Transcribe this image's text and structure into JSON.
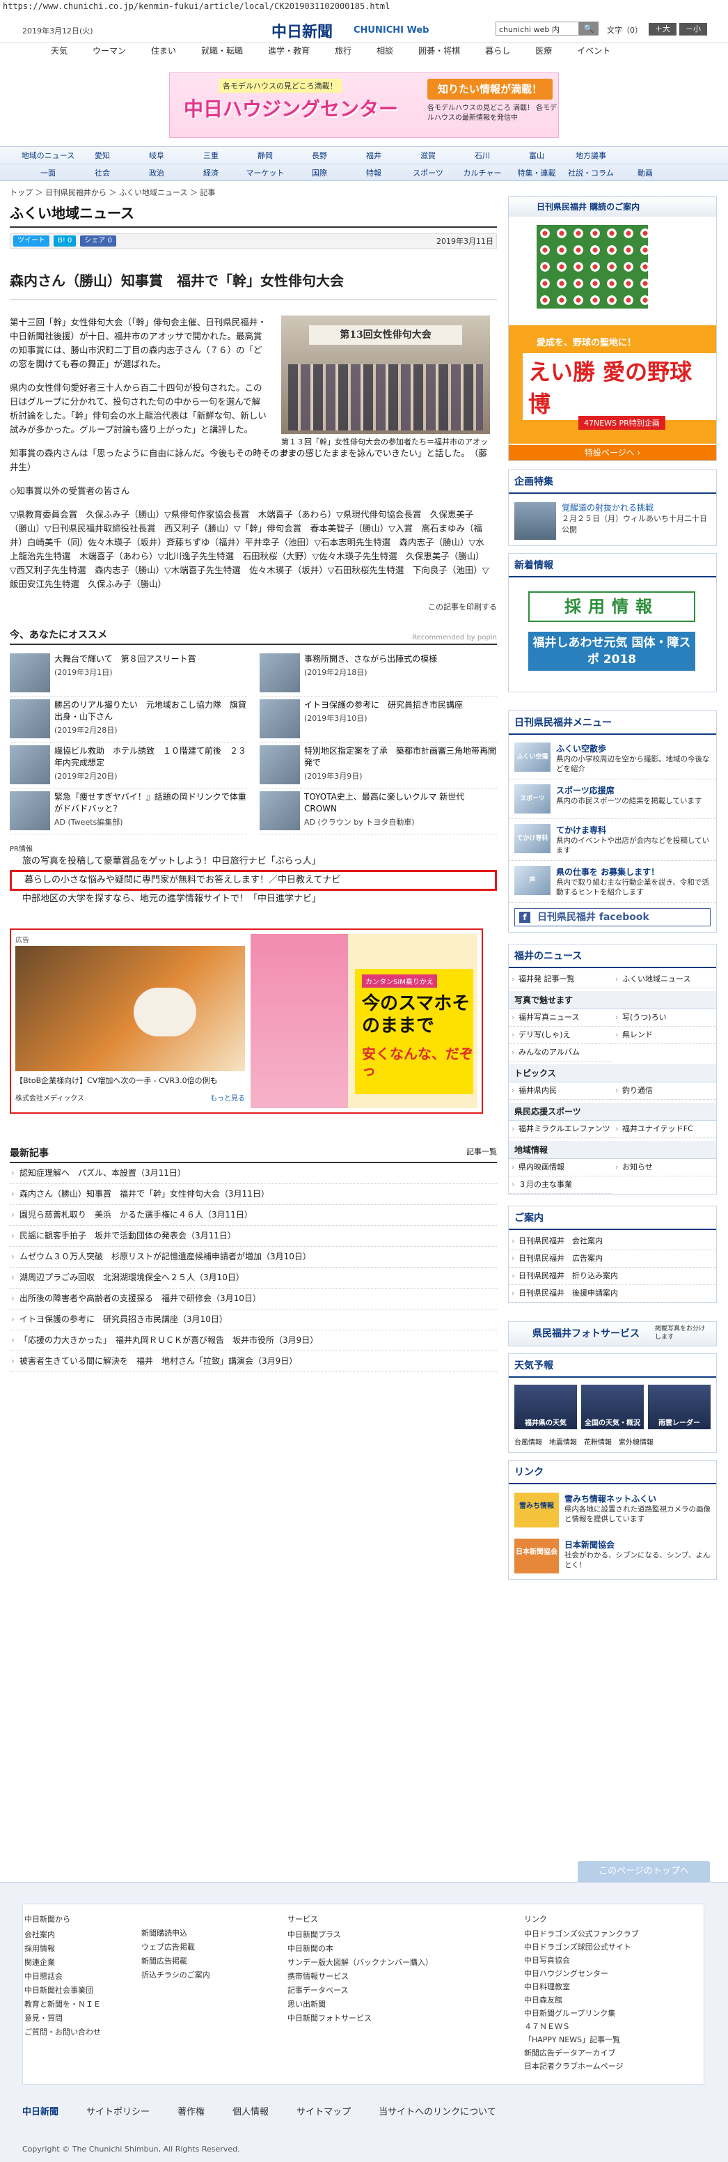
{
  "url_bar": "https://www.chunichi.co.jp/kenmin-fukui/article/local/CK2019031102000185.html",
  "header": {
    "date": "2019年3月12日(火)",
    "logo": "中日新聞",
    "logo_sub": "CHUNICHI Web",
    "search_value": "chunichi web 内",
    "search_btn": "🔍",
    "fontsize_label": "文字（0）",
    "font_big": "＋大",
    "font_small": "－小",
    "gnav": [
      "天気",
      "ウーマン",
      "住まい",
      "就職・転職",
      "進学・教育",
      "旅行",
      "相談",
      "囲碁・将棋",
      "暮らし",
      "医療",
      "イベント"
    ]
  },
  "banner": {
    "sub": "各モデルハウスの見どころ満載！",
    "title": "中日ハウジングセンター",
    "right": "知りたい情報が満載！",
    "right2": "各モデルハウスの見どころ 満載！ 各モデルハウスの最新情報を発信中"
  },
  "cat_nav": {
    "row1": [
      "地域のニュース",
      "愛知",
      "岐阜",
      "三重",
      "静岡",
      "長野",
      "福井",
      "滋賀",
      "石川",
      "富山",
      "地方議事"
    ],
    "row2": [
      "一面",
      "社会",
      "政治",
      "経済",
      "マーケット",
      "国際",
      "特報",
      "スポーツ",
      "カルチャー",
      "特集・連載",
      "社説・コラム",
      "動画"
    ]
  },
  "main": {
    "breadcrumb": "トップ ＞ 日刊県民福井から ＞ ふくい地域ニュース ＞ 記事",
    "section_title": "ふくい地域ニュース",
    "social": {
      "tweet": "ツイート",
      "b": "B! 0",
      "share": "シェア 0"
    },
    "pubdate": "2019年3月11日",
    "article_title": "森内さん（勝山）知事賞　福井で「幹」女性俳句大会",
    "p1": "第十三回「幹」女性俳句大会（「幹」俳句会主催、日刊県民福井・中日新聞社後援）が十日、福井市のアオッサで開かれた。最高賞の知事賞には、勝山市沢町二丁目の森内志子さん（７６）の「どの窓を開けても春の舞正」が選ばれた。",
    "p2": "県内の女性俳句愛好者三十人から百二十四句が投句された。この日はグループに分かれて、投句された句の中から一句を選んで解析討論をした。「幹」俳句会の水上龍治代表は「新鮮な句、新しい試みが多かった。グループ討論も盛り上がった」と講評した。",
    "p3": "知事賞の森内さんは「思ったように自由に詠んだ。今後もその時そのままの感じたままを詠んでいきたい」と話した。　（藤井生）",
    "p4": "◇知事賞以外の受賞者の皆さん",
    "p5": "▽県教育委員会賞　久保ふみ子（勝山）▽県俳句作家協会長賞　木端喜子（あわら）▽県現代俳句協会長賞　久保恵美子（勝山）▽日刊県民福井取締役社長賞　西又利子（勝山）▽「幹」俳句会賞　春本美智子（勝山）▽入賞　高石まゆみ（福井）白崎美千（同）佐々木瑛子（坂井）斉藤ちずゆ（福井）平井幸子（池田）▽石本志明先生特選　森内志子（勝山）▽水上龍治先生特選　木端喜子（あわら）▽北川逸子先生特選　石田秋桜（大野）▽佐々木瑛子先生特選　久保恵美子（勝山）▽西又利子先生特選　森内志子（勝山）▽木端喜子先生特選　佐々木瑛子（坂井）▽石田秋桜先生特選　下向良子（池田）▽飯田安江先生特選　久保ふみ子（勝山）",
    "photo_cap": "第１３回「幹」女性俳句大会の参加者たち＝福井市のアオッサで",
    "photo_banner": "第13回女性俳句大会",
    "print_link": "この記事を印刷する",
    "rec_title": "今、あなたにオススメ",
    "rec_by": "Recommended by popIn",
    "recs": [
      {
        "t": "大舞台で輝いて　第８回アスリート賞",
        "d": "(2019年3月1日)"
      },
      {
        "t": "事務所開き、さながら出陣式の模様",
        "d": "(2019年2月18日)"
      },
      {
        "t": "勝呂のリアル撮りたい　元地域おこし協力隊　旗貸出身・山下さん",
        "d": "(2019年2月28日)"
      },
      {
        "t": "イトヨ保護の参考に　研究員招き市民講座",
        "d": "(2019年3月10日)"
      },
      {
        "t": "繊協ビル救助　ホテル誘致　１０階建て前後　２３年内完成想定",
        "d": "(2019年2月20日)"
      },
      {
        "t": "特別地区指定案を了承　築都市計画審三角地帯再開発で",
        "d": "(2019年3月9日)"
      },
      {
        "t": "緊急『痩せすぎヤバイ！』話題の岡ドリンクで体重がドバドバッと？",
        "d": "AD (Tweets編集部)"
      },
      {
        "t": "TOYOTA史上、最高に楽しいクルマ 新世代CROWN",
        "d": "AD (クラウン by トヨタ自動車)"
      }
    ],
    "pr_label": "PR情報",
    "pr": [
      "旅の写真を投稿して豪華賞品をゲットしよう！中日旅行ナビ「ぶらっ人」",
      "暮らしの小さな悩みや疑問に専門家が無料でお答えします！／中日教えてナビ",
      "中部地区の大学を探すなら、地元の進学情報サイトで！「中日進学ナビ」"
    ],
    "ad_tag": "広告",
    "ad1_cap": "【BtoB企業様向け】CV増加へ次の一手 - CVR3.0倍の例も",
    "ad1_sponsor": "株式会社メディックス",
    "ad1_more": "もっと見る",
    "ad2_t1": "カンタンSIM乗りかえ",
    "ad2_t2": "今のスマホそのままで",
    "ad2_t3": "安くなんな、だぞっ",
    "latest_title": "最新記事",
    "latest_more": "記事一覧",
    "latest": [
      "認知症理解へ　パズル、本設置（3月11日）",
      "森内さん（勝山）知事賞　福井で「幹」女性俳句大会（3月11日）",
      "園児ら慈善札取り　美浜　かるた選手権に４６人（3月11日）",
      "民謡に観客手拍子　坂井で活動団体の発表会（3月11日）",
      "ムゼウム３０万人突破　杉原リストが記憶遺産候補申請者が増加（3月10日）",
      "湖周辺プラごみ回収　北潟湖環境保全へ２５人（3月10日）",
      "出所後の障害者や高齢者の支援探る　福井で研修会（3月10日）",
      "イトヨ保護の参考に　研究員招き市民講座（3月10日）",
      "「応援の力大きかった」　福井丸岡ＲＵＣＫが喜び報告　坂井市役所（3月9日）",
      "被害者生きている間に解決を　福井　地村さん「拉致」講演会（3月9日）"
    ]
  },
  "side": {
    "kenmin_head": "日刊県民福井 購読のご案内",
    "kenmin_o1": "愛成を、野球の聖地に！",
    "kenmin_o2": "えい勝 愛の野球博",
    "kenmin_o3": "47NEWS PR特別企画",
    "kenmin_foot": "特設ページへ ›",
    "topic_title": "企画特集",
    "topic_t": "覚醒道の射抜かれる挑戦",
    "topic_d": "２月２５日（月）ウィルあいち十月二十日公開",
    "newinfo_title": "新着情報",
    "recruit1": "採用情報",
    "recruit2": "福井しあわせ元気 国体・障スポ 2018",
    "menu_title": "日刊県民福井メニュー",
    "menu": [
      {
        "logo": "ふくい空撮",
        "t": "ふくい空散歩",
        "d": "県内の小学校周辺を空から撮影。地域の今後などを紹介"
      },
      {
        "logo": "スポーツ",
        "t": "スポーツ応援席",
        "d": "県内の市民スポーツの結果を掲載しています"
      },
      {
        "logo": "てかけ専科",
        "t": "てかけま専科",
        "d": "県内のイベントや出店が会内などを投稿しています"
      },
      {
        "logo": "声",
        "t": "県の仕事を お募集します！",
        "d": "県内で取り組む主な行動企業を説き、令和で活動するヒントを紹介します"
      }
    ],
    "fb": "日刊県民福井 facebook",
    "fb_icon": "f",
    "news_title": "福井のニュース",
    "news1": [
      "福井発 記事一覧",
      "ふくい地域ニュース"
    ],
    "news_photo_h": "写真で魅せます",
    "news2": [
      "福井写真ニュース",
      "写(うつ)ろい",
      "デリ写(しゃ)え",
      "県レンド",
      "みんなのアルバム"
    ],
    "news_topics_h": "トピックス",
    "news3": [
      "福井県内民",
      "釣り通信"
    ],
    "news_sports_h": "県民応援スポーツ",
    "news4": [
      "福井ミラクルエレファンツ",
      "福井ユナイテッドFC"
    ],
    "news_local_h": "地域情報",
    "news5": [
      "県内映画情報",
      "お知らせ",
      "３月の主な事業"
    ],
    "guide_title": "ご案内",
    "guide": [
      "日刊県民福井　会社案内",
      "日刊県民福井　広告案内",
      "日刊県民福井　折り込み案内",
      "日刊県民福井　後援申請案内"
    ],
    "photo_svc": "県民福井フォトサービス",
    "photo_svc_sm": "掲載写真をお分けします",
    "weather_title": "天気予報",
    "weather": [
      "福井県の天気",
      "全国の天気・概況",
      "雨雲レーダー"
    ],
    "wlinks": [
      "台風情報",
      "地震情報",
      "花粉情報",
      "紫外線情報"
    ],
    "link_title": "リンク",
    "links": [
      {
        "logo": "雪みち情報",
        "t": "雪みち情報ネットふくい",
        "d": "県内各地に設置された道路監視カメラの画像と情報を提供しています"
      },
      {
        "logo": "日本新聞協会",
        "t": "日本新聞協会",
        "d": "社会がわかる、シブンになる、シンプ、よんとく！"
      }
    ]
  },
  "footer": {
    "pagetop": "このページのトップへ",
    "col1_h": "中日新聞から",
    "col1": [
      "会社案内",
      "採用情報",
      "関連企業",
      "中日懇話会",
      "中日新聞社会事業団",
      "教育と新聞を・ＮＩＥ",
      "意見・質問",
      "ご質問・お問い合わせ"
    ],
    "col2": [
      "新聞購読申込",
      "ウェブ広告掲載",
      "新聞広告掲載",
      "折込チラシのご案内"
    ],
    "col3_h": "サービス",
    "col3": [
      "中日新聞プラス",
      "中日新聞の本",
      "サンデー版大図解（バックナンバー購入）",
      "携帯情報サービス",
      "記事データベース",
      "思い出新聞",
      "中日新聞フォトサービス"
    ],
    "col4_h": "リンク",
    "col4": [
      "中日ドラゴンズ公式ファンクラブ",
      "中日ドラゴンズ球団公式サイト",
      "中日写真協会",
      "中日ハウジングセンター",
      "中日料理教室",
      "中日森友館",
      "中日新聞グループリンク集",
      "４７ＮＥＷＳ",
      "「HAPPY NEWS」記事一覧",
      "新聞広告データアーカイブ",
      "日本記者クラブホームページ"
    ],
    "bar_logo": "中日新聞",
    "bar": [
      "サイトポリシー",
      "著作権",
      "個人情報",
      "サイトマップ",
      "当サイトへのリンクについて"
    ],
    "copyright": "Copyright © The Chunichi Shimbun, All Rights Reserved."
  }
}
